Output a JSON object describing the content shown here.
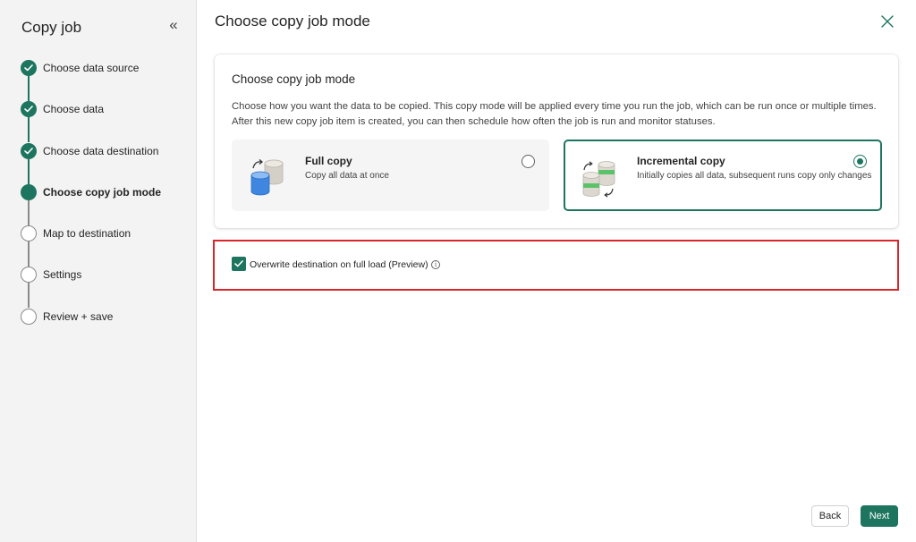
{
  "sidebar": {
    "title": "Copy job",
    "collapse_icon": "chevron-double-left-icon",
    "steps": [
      {
        "label": "Choose data source",
        "status": "done"
      },
      {
        "label": "Choose data",
        "status": "done"
      },
      {
        "label": "Choose data destination",
        "status": "done"
      },
      {
        "label": "Choose copy job mode",
        "status": "current"
      },
      {
        "label": "Map to destination",
        "status": "todo"
      },
      {
        "label": "Settings",
        "status": "todo"
      },
      {
        "label": "Review + save",
        "status": "todo"
      }
    ]
  },
  "main": {
    "title": "Choose copy job mode",
    "card": {
      "title": "Choose copy job mode",
      "description": "Choose how you want the data to be copied. This copy mode will be applied every time you run the job, which can be run once or multiple times. After this new copy job item is created, you can then schedule how often the job is run and monitor statuses.",
      "options": [
        {
          "name": "Full copy",
          "description": "Copy all data at once",
          "selected": false
        },
        {
          "name": "Incremental copy",
          "description": "Initially copies all data, subsequent runs copy only changes",
          "selected": true
        }
      ]
    },
    "overwrite": {
      "label": "Overwrite destination on full load (Preview)",
      "checked": true,
      "info_icon": "info-icon"
    }
  },
  "footer": {
    "back_label": "Back",
    "next_label": "Next"
  },
  "colors": {
    "accent": "#1d7560",
    "highlight": "#d9262b"
  }
}
